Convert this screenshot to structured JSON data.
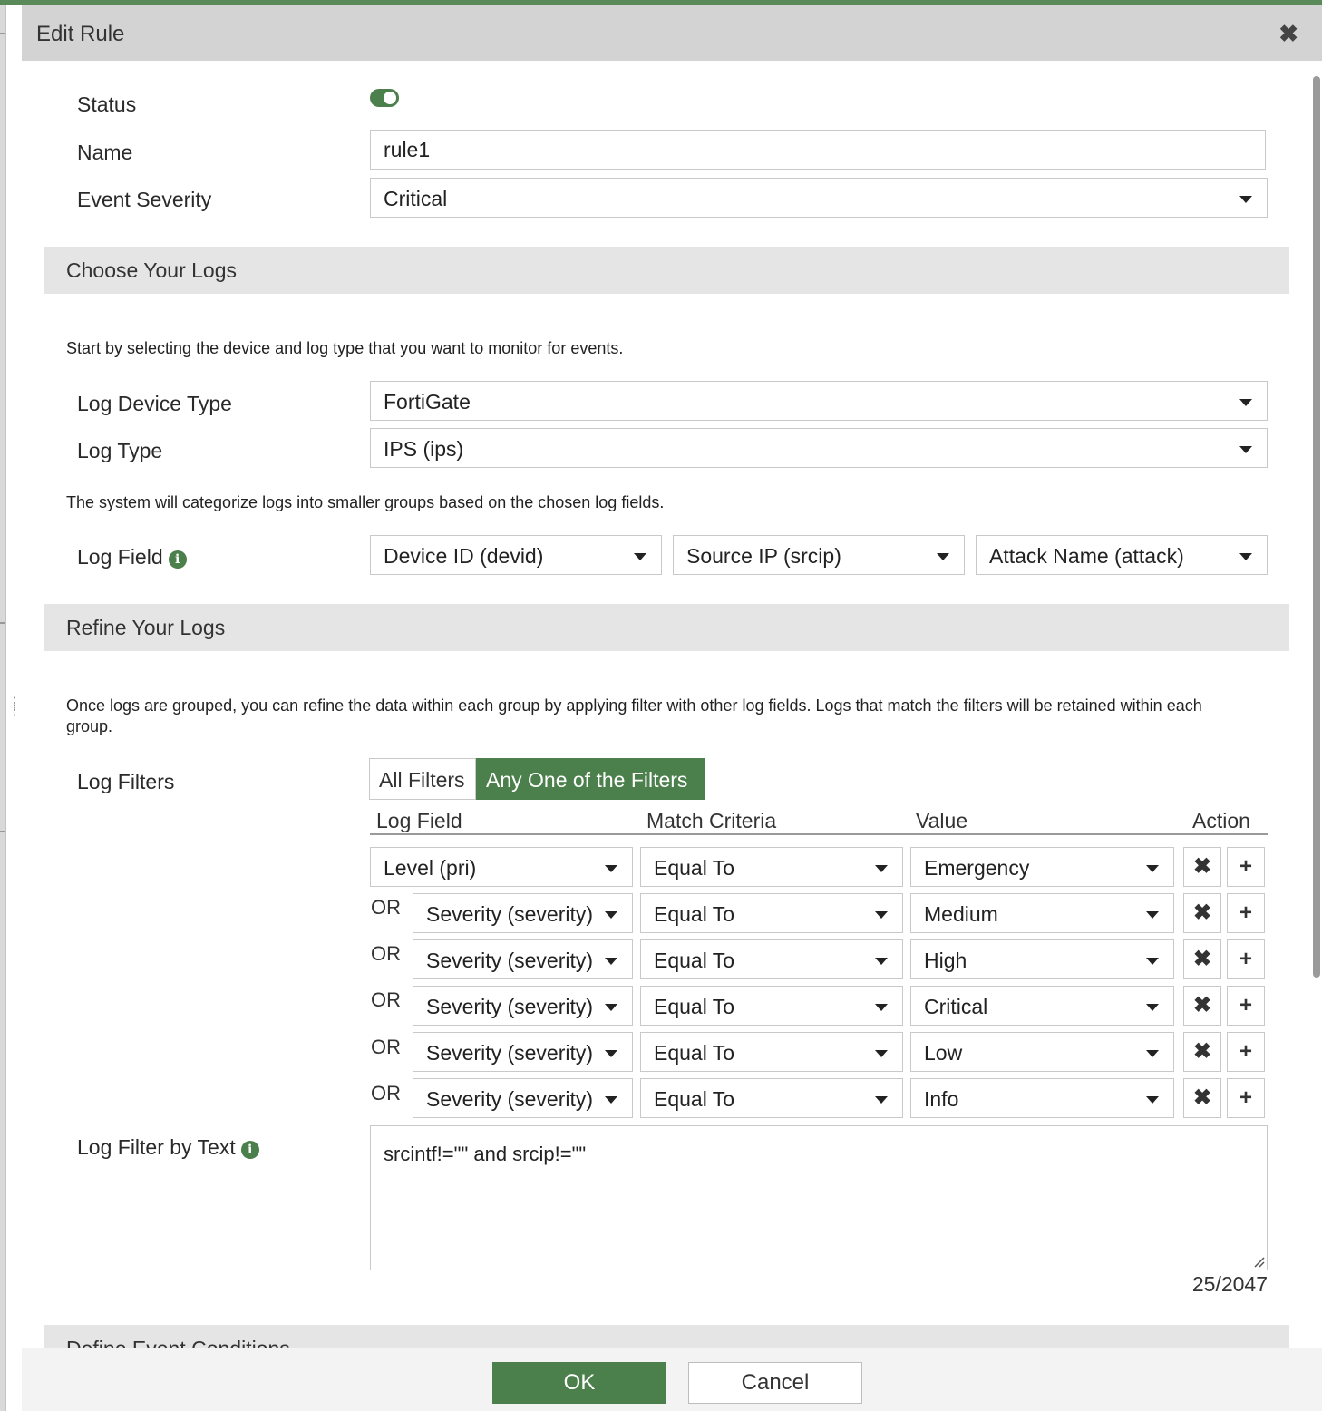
{
  "dialog": {
    "title": "Edit Rule",
    "close_icon": "close-icon"
  },
  "fields": {
    "status_label": "Status",
    "status_on": true,
    "name_label": "Name",
    "name_value": "rule1",
    "severity_label": "Event Severity",
    "severity_value": "Critical"
  },
  "choose_logs": {
    "title": "Choose Your Logs",
    "hint": "Start by selecting the device and log type that you want to monitor for events.",
    "device_type_label": "Log Device Type",
    "device_type_value": "FortiGate",
    "log_type_label": "Log Type",
    "log_type_value": "IPS (ips)",
    "group_hint": "The system will categorize logs into smaller groups based on the chosen log fields.",
    "log_field_label": "Log Field",
    "log_fields": [
      "Device ID (devid)",
      "Source IP (srcip)",
      "Attack Name (attack)"
    ]
  },
  "refine_logs": {
    "title": "Refine Your Logs",
    "hint": "Once logs are grouped, you can refine the data within each group by applying filter with other log fields. Logs that match the filters will be retained within each group.",
    "filters_label": "Log Filters",
    "mode_all": "All Filters",
    "mode_any": "Any One of the Filters",
    "active_mode": "Any One of the Filters",
    "columns": [
      "Log Field",
      "Match Criteria",
      "Value",
      "Action"
    ],
    "rows": [
      {
        "prefix": "",
        "field": "Level (pri)",
        "criteria": "Equal To",
        "value": "Emergency"
      },
      {
        "prefix": "OR",
        "field": "Severity (severity)",
        "criteria": "Equal To",
        "value": "Medium"
      },
      {
        "prefix": "OR",
        "field": "Severity (severity)",
        "criteria": "Equal To",
        "value": "High"
      },
      {
        "prefix": "OR",
        "field": "Severity (severity)",
        "criteria": "Equal To",
        "value": "Critical"
      },
      {
        "prefix": "OR",
        "field": "Severity (severity)",
        "criteria": "Equal To",
        "value": "Low"
      },
      {
        "prefix": "OR",
        "field": "Severity (severity)",
        "criteria": "Equal To",
        "value": "Info"
      }
    ],
    "text_filter_label": "Log Filter by Text",
    "text_filter_value": "srcintf!=\"\" and srcip!=\"\"",
    "text_filter_counter": "25/2047"
  },
  "next_section": {
    "title": "Define Event Conditions"
  },
  "footer": {
    "ok": "OK",
    "cancel": "Cancel"
  },
  "colors": {
    "accent": "#4b7f4b",
    "section_bg": "#e5e5e5",
    "title_bg": "#d3d3d3"
  }
}
